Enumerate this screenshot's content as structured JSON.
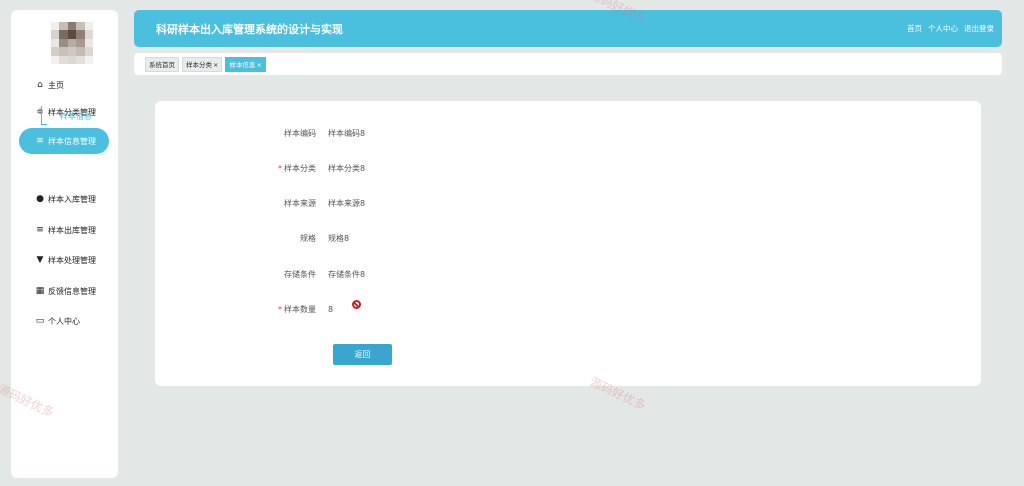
{
  "header": {
    "title": "科研样本出入库管理系统的设计与实现",
    "links": [
      "首页",
      "个人中心",
      "退出登录"
    ]
  },
  "sidebar": {
    "items": [
      {
        "label": "主页",
        "icon": "home-icon",
        "glyph": "⌂"
      },
      {
        "label": "样本分类管理",
        "icon": "sliders-icon",
        "glyph": "≑"
      },
      {
        "label": "样本信息管理",
        "icon": "list-icon",
        "glyph": "≡"
      },
      {
        "label": "样本入库管理",
        "icon": "user-icon",
        "glyph": "●"
      },
      {
        "label": "样本出库管理",
        "icon": "list-icon",
        "glyph": "≡"
      },
      {
        "label": "样本处理管理",
        "icon": "filter-icon",
        "glyph": "▼"
      },
      {
        "label": "反馈信息管理",
        "icon": "grid-icon",
        "glyph": "▦"
      },
      {
        "label": "个人中心",
        "icon": "card-icon",
        "glyph": "▭"
      }
    ],
    "active_index": 2,
    "submenu_label": "样本信息"
  },
  "tabs": [
    {
      "label": "系统首页",
      "closable": false,
      "active": false
    },
    {
      "label": "样本分类",
      "closable": true,
      "active": false
    },
    {
      "label": "样本信息",
      "closable": true,
      "active": true
    }
  ],
  "tab_close_glyph": "×",
  "form": {
    "fields": [
      {
        "label": "样本编码",
        "value": "样本编码8",
        "required": false
      },
      {
        "label": "样本分类",
        "value": "样本分类8",
        "required": true
      },
      {
        "label": "样本来源",
        "value": "样本来源8",
        "required": false
      },
      {
        "label": "规格",
        "value": "规格8",
        "required": false
      },
      {
        "label": "存储条件",
        "value": "存储条件8",
        "required": false
      },
      {
        "label": "样本数量",
        "value": "8",
        "required": true
      }
    ],
    "required_mark": "*",
    "back_button": "返回"
  },
  "watermark": "源码好优多",
  "colors": {
    "accent": "#4bbfde",
    "button": "#3aa5cf",
    "required": "#e23b3b",
    "background": "#e3e8e6"
  }
}
